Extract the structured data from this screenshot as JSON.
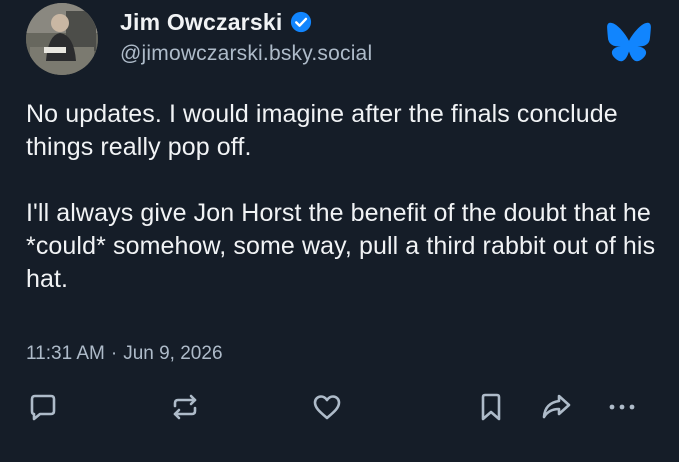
{
  "post": {
    "author": {
      "display_name": "Jim Owczarski",
      "handle": "@jimowczarski.bsky.social",
      "verified": true
    },
    "paragraphs": [
      "No updates. I would imagine after the finals conclude things really pop off.",
      "I'll always give Jon Horst the benefit of the doubt that he *could* somehow, some way, pull a third rabbit out of his hat."
    ],
    "time": "11:31 AM",
    "separator": "·",
    "date": "Jun 9, 2026"
  },
  "actions": [
    {
      "name": "reply",
      "icon": "speech-bubble-icon"
    },
    {
      "name": "repost",
      "icon": "repost-icon"
    },
    {
      "name": "like",
      "icon": "heart-icon"
    },
    {
      "name": "bookmark",
      "icon": "bookmark-icon"
    },
    {
      "name": "share",
      "icon": "share-arrow-icon"
    },
    {
      "name": "more",
      "icon": "ellipsis-icon"
    }
  ],
  "colors": {
    "background": "#151d28",
    "text": "#f1f3f5",
    "muted": "#aebbc9",
    "brand_blue": "#1185fe"
  }
}
